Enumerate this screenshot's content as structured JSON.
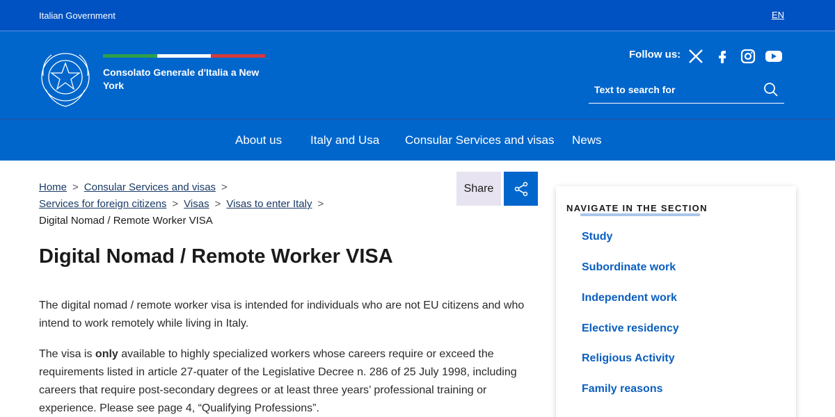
{
  "topbar": {
    "gov_label": "Italian Government",
    "lang": "EN"
  },
  "header": {
    "consolate": "Consolato Generale d'Italia a New York",
    "follow_label": "Follow us:",
    "social": [
      "x-icon",
      "facebook-icon",
      "instagram-icon",
      "youtube-icon"
    ],
    "search_placeholder": "Text to search for",
    "flag_colors": [
      "#2e9f4a",
      "#ffffff",
      "#d53a3a"
    ]
  },
  "nav": {
    "items": [
      {
        "label": "About us"
      },
      {
        "label": "Italy and Usa"
      },
      {
        "label": "Consular Services and visas"
      },
      {
        "label": "News"
      }
    ]
  },
  "breadcrumb": {
    "items": [
      {
        "label": "Home"
      },
      {
        "label": "Consular Services and visas"
      },
      {
        "label": "Services for foreign citizens"
      },
      {
        "label": "Visas"
      },
      {
        "label": "Visas to enter Italy"
      }
    ],
    "current": "Digital Nomad / Remote Worker VISA",
    "separator": ">"
  },
  "share": {
    "label": "Share"
  },
  "main": {
    "title": "Digital Nomad / Remote Worker VISA",
    "p1": "The digital nomad / remote worker visa is intended for individuals who are not EU citizens and who intend to work remotely while living in Italy.",
    "p2_before": "The visa is ",
    "p2_bold": "only",
    "p2_after": " available to highly specialized workers whose careers require or exceed the requirements listed in article 27-quater of the Legislative Decree n. 286 of 25 July 1998, including careers that require post-secondary degrees or at least three years’ professional training or experience. Please see page 4, “Qualifying Professions”."
  },
  "sidebar": {
    "heading": "NAVIGATE IN THE SECTION",
    "items": [
      {
        "label": "Study"
      },
      {
        "label": "Subordinate work"
      },
      {
        "label": "Independent work"
      },
      {
        "label": "Elective residency"
      },
      {
        "label": "Religious Activity"
      },
      {
        "label": "Family reasons"
      }
    ]
  },
  "colors": {
    "topbar": "#0052c2",
    "header": "#0066cc",
    "link": "#0b5fbf"
  }
}
